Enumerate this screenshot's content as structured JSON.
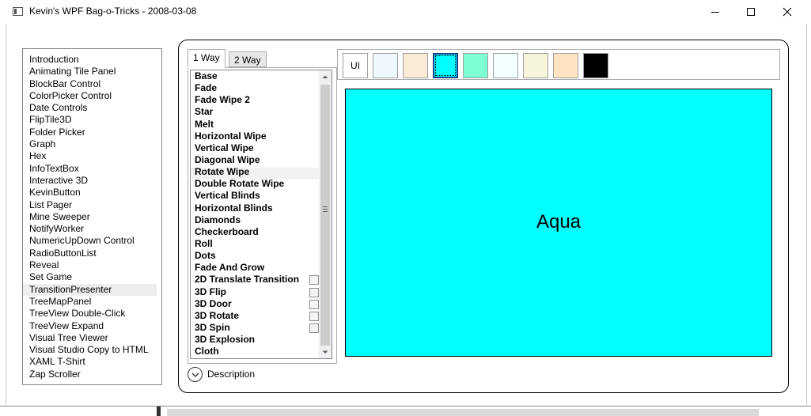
{
  "window": {
    "title": "Kevin's WPF Bag-o-Tricks - 2008-03-08"
  },
  "sidebar": {
    "items": [
      "Introduction",
      "Animating Tile Panel",
      "BlockBar Control",
      "ColorPicker Control",
      "Date Controls",
      "FlipTile3D",
      "Folder Picker",
      "Graph",
      "Hex",
      "InfoTextBox",
      "Interactive 3D",
      "KevinButton",
      "List Pager",
      "Mine Sweeper",
      "NotifyWorker",
      "NumericUpDown Control",
      "RadioButtonList",
      "Reveal",
      "Set Game",
      "TransitionPresenter",
      "TreeMapPanel",
      "TreeView Double-Click",
      "TreeView Expand",
      "Visual Tree Viewer",
      "Visual Studio Copy to HTML",
      "XAML T-Shirt",
      "Zap Scroller"
    ],
    "selected": "TransitionPresenter"
  },
  "tabs": [
    {
      "label": "1 Way",
      "active": true
    },
    {
      "label": "2 Way",
      "active": false
    }
  ],
  "transitions": [
    {
      "label": "Base",
      "checkbox": false
    },
    {
      "label": "Fade",
      "checkbox": false
    },
    {
      "label": "Fade Wipe 2",
      "checkbox": false
    },
    {
      "label": "Star",
      "checkbox": false
    },
    {
      "label": "Melt",
      "checkbox": false
    },
    {
      "label": "Horizontal Wipe",
      "checkbox": false
    },
    {
      "label": "Vertical Wipe",
      "checkbox": false
    },
    {
      "label": "Diagonal Wipe",
      "checkbox": false
    },
    {
      "label": "Rotate Wipe",
      "checkbox": false
    },
    {
      "label": "Double Rotate Wipe",
      "checkbox": false
    },
    {
      "label": "Vertical Blinds",
      "checkbox": false
    },
    {
      "label": "Horizontal Blinds",
      "checkbox": false
    },
    {
      "label": "Diamonds",
      "checkbox": false
    },
    {
      "label": "Checkerboard",
      "checkbox": false
    },
    {
      "label": "Roll",
      "checkbox": false
    },
    {
      "label": "Dots",
      "checkbox": false
    },
    {
      "label": "Fade And Grow",
      "checkbox": false
    },
    {
      "label": "2D Translate Transition",
      "checkbox": true
    },
    {
      "label": "3D Flip",
      "checkbox": true
    },
    {
      "label": "3D Door",
      "checkbox": true
    },
    {
      "label": "3D Rotate",
      "checkbox": true
    },
    {
      "label": "3D Spin",
      "checkbox": true
    },
    {
      "label": "3D Explosion",
      "checkbox": false
    },
    {
      "label": "Cloth",
      "checkbox": false
    }
  ],
  "description": {
    "label": "Description"
  },
  "swatches": {
    "ui_label": "UI",
    "colors": [
      "#f0f8ff",
      "#faebd7",
      "#00ffff",
      "#7fffd4",
      "#f0ffff",
      "#f5f5dc",
      "#ffe4c4",
      "#000000"
    ],
    "selected_index": 2
  },
  "display": {
    "label": "Aqua",
    "color": "#00ffff"
  }
}
